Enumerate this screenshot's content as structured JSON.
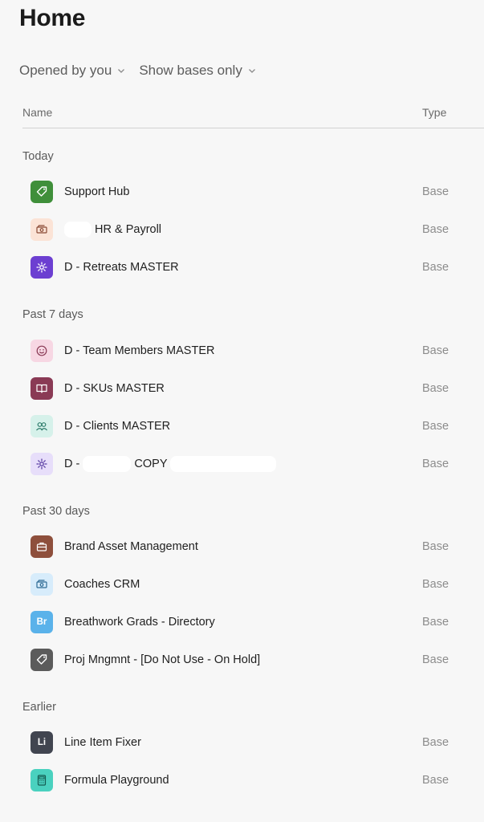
{
  "page": {
    "title": "Home"
  },
  "filters": [
    {
      "label": "Opened by you"
    },
    {
      "label": "Show bases only"
    }
  ],
  "columns": {
    "name": "Name",
    "type": "Type"
  },
  "sections": [
    {
      "label": "Today",
      "rows": [
        {
          "name": "Support Hub",
          "type": "Base",
          "icon": "tag-icon",
          "color": "#3f8f3a"
        },
        {
          "name_suffix": "HR & Payroll",
          "type": "Base",
          "icon": "money-icon",
          "color": "#fbe3d6"
        },
        {
          "name": "D - Retreats MASTER",
          "type": "Base",
          "icon": "gear-icon",
          "color": "#6c3fd1"
        }
      ]
    },
    {
      "label": "Past 7 days",
      "rows": [
        {
          "name": "D - Team Members MASTER",
          "type": "Base",
          "icon": "smile-icon",
          "color": "#f7d7e3"
        },
        {
          "name": "D - SKUs MASTER",
          "type": "Base",
          "icon": "book-icon",
          "color": "#8a3a55"
        },
        {
          "name": "D - Clients MASTER",
          "type": "Base",
          "icon": "users-icon",
          "color": "#d6f1ea"
        },
        {
          "name_prefix": "D -",
          "name_middle": "COPY",
          "type": "Base",
          "icon": "gear-icon",
          "color": "#e7defa"
        }
      ]
    },
    {
      "label": "Past 30 days",
      "rows": [
        {
          "name": "Brand Asset Management",
          "type": "Base",
          "icon": "briefcase-icon",
          "color": "#8e4f3c"
        },
        {
          "name": "Coaches CRM",
          "type": "Base",
          "icon": "money-icon",
          "color": "#d7ecfb"
        },
        {
          "name": "Breathwork Grads - Directory",
          "type": "Base",
          "icon": "br-text-icon",
          "icon_text": "Br",
          "color": "#5ab2ea"
        },
        {
          "name": "Proj Mngmnt - [Do Not Use - On Hold]",
          "type": "Base",
          "icon": "tag-icon",
          "color": "#5b5b5b"
        }
      ]
    },
    {
      "label": "Earlier",
      "rows": [
        {
          "name": "Line Item Fixer",
          "type": "Base",
          "icon": "li-text-icon",
          "icon_text": "Li",
          "color": "#414550"
        },
        {
          "name": "Formula Playground",
          "type": "Base",
          "icon": "calculator-icon",
          "color": "#4ad1bf"
        }
      ]
    }
  ]
}
